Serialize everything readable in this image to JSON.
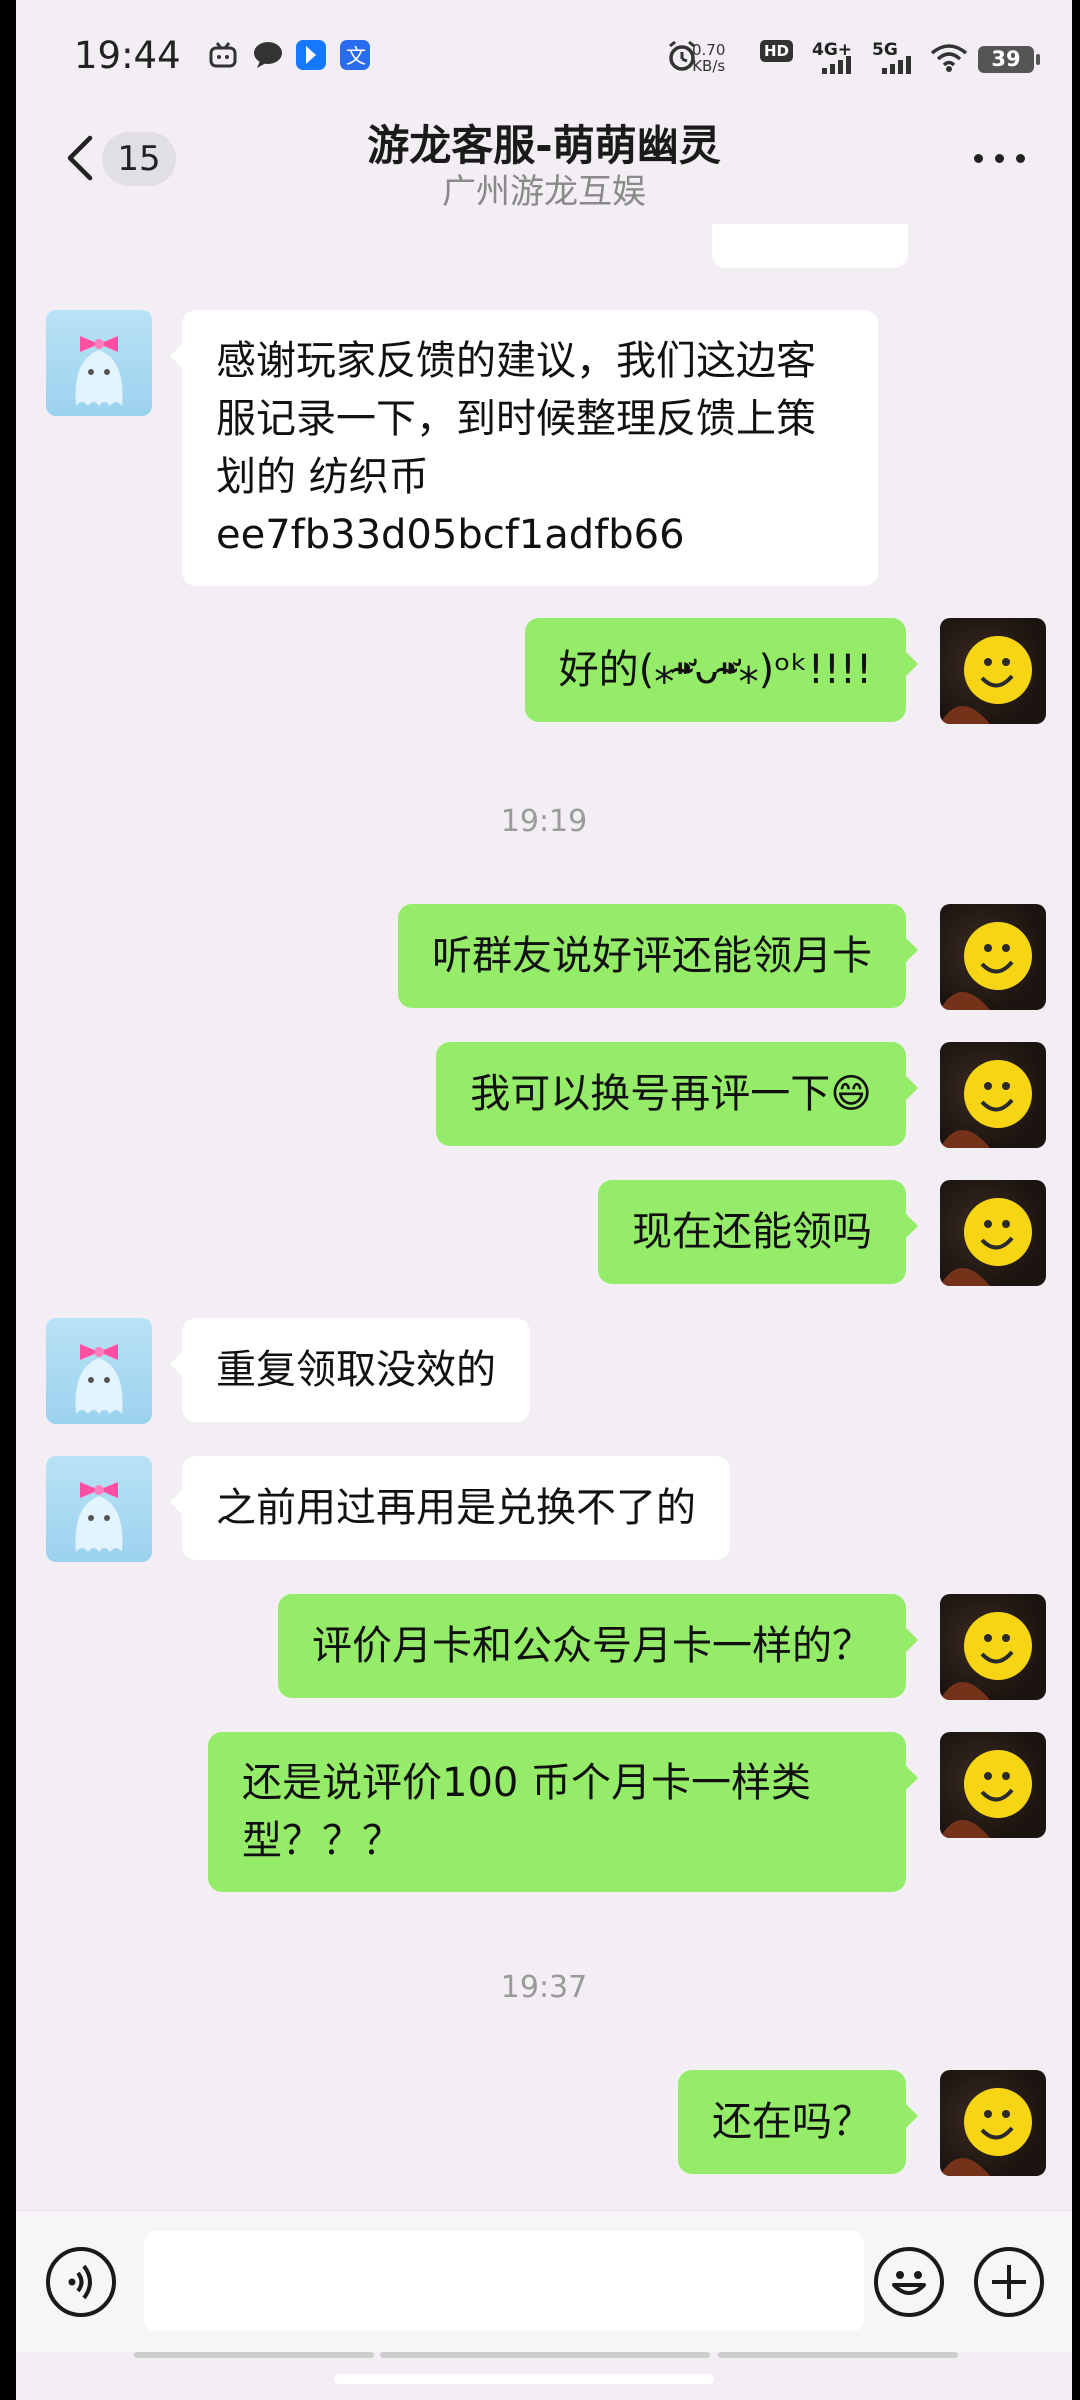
{
  "status_bar": {
    "time": "19:44",
    "speed_value": "0.70",
    "speed_unit": "KB/s",
    "hd_label": "HD",
    "net1": "4G+",
    "net2": "5G",
    "battery": "39"
  },
  "header": {
    "back_count": "15",
    "title": "游龙客服-萌萌幽灵",
    "subtitle": "广州游龙互娱"
  },
  "messages": [
    {
      "from": "them",
      "text": "感谢玩家反馈的建议，我们这边客服记录一下，到时候整理反馈上策划的 纺织币 ee7fb33d05bcf1adfb66"
    },
    {
      "from": "me",
      "text": "好的(⁎⁍̴̛ᴗ⁍̴̛⁎)ᵒᵏ!!!!"
    },
    {
      "type": "time",
      "text": "19:19"
    },
    {
      "from": "me",
      "text": "听群友说好评还能领月卡"
    },
    {
      "from": "me",
      "text": "我可以换号再评一下😄"
    },
    {
      "from": "me",
      "text": "现在还能领吗"
    },
    {
      "from": "them",
      "text": "重复领取没效的"
    },
    {
      "from": "them",
      "text": "之前用过再用是兑换不了的"
    },
    {
      "from": "me",
      "text": "评价月卡和公众号月卡一样的？"
    },
    {
      "from": "me",
      "text": "还是说评价100 币个月卡一样类型？？？"
    },
    {
      "type": "time",
      "text": "19:37"
    },
    {
      "from": "me",
      "text": "还在吗？"
    }
  ],
  "input": {
    "placeholder": ""
  },
  "colors": {
    "outgoing_bubble": "#95ec69",
    "incoming_bubble": "#ffffff",
    "background": "#f2eef4"
  }
}
